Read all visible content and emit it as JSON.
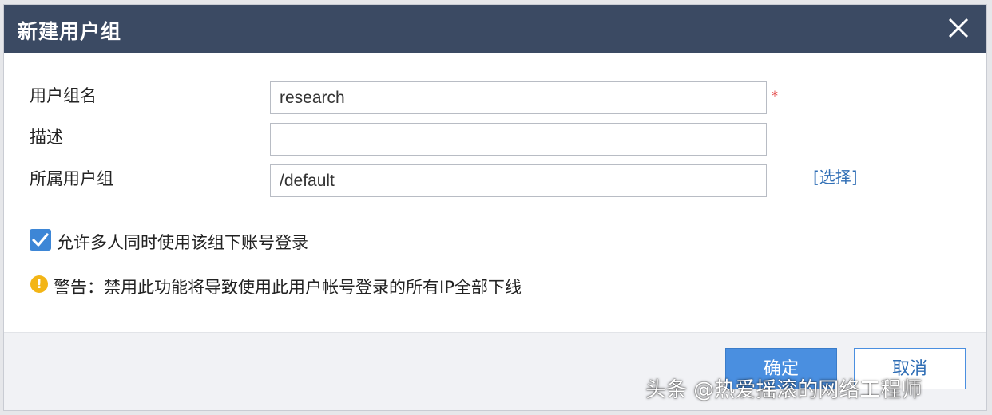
{
  "dialog": {
    "title": "新建用户组",
    "close_icon": "close-icon"
  },
  "form": {
    "group_name": {
      "label": "用户组名",
      "value": "research",
      "required_mark": "*"
    },
    "description": {
      "label": "描述",
      "value": ""
    },
    "parent_group": {
      "label": "所属用户组",
      "value": "/default",
      "select_link": "[选择]"
    },
    "allow_multi_login": {
      "label": "允许多人同时使用该组下账号登录",
      "checked": true
    },
    "warning": {
      "icon": "warning-icon",
      "text": "警告：禁用此功能将导致使用此用户帐号登录的所有IP全部下线"
    }
  },
  "footer": {
    "ok_label": "确定",
    "cancel_label": "取消"
  },
  "watermark": "头条 @热爱摇滚的网络工程师",
  "colors": {
    "titlebar": "#3b4a63",
    "primary": "#4a8fe0",
    "link": "#2f6eb5",
    "required": "#e34a4a",
    "warning": "#f3b516"
  }
}
